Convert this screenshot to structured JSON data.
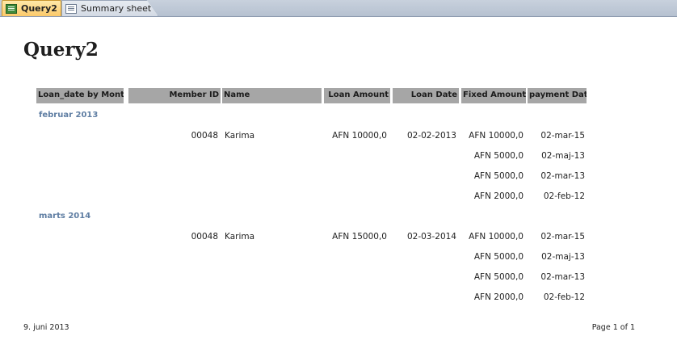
{
  "tabs": [
    {
      "label": "Query2",
      "active": true,
      "icon": "query-icon"
    },
    {
      "label": "Summary sheet",
      "active": false,
      "icon": "report-icon"
    }
  ],
  "report": {
    "title": "Query2",
    "columns": [
      "Loan_date by Month",
      "Member ID",
      "Name",
      "Loan Amount",
      "Loan Date",
      "Fixed Amount",
      "payment Date"
    ],
    "groups": [
      {
        "label": "februar 2013",
        "member_id": "00048",
        "name": "Karima",
        "loan_amount": "AFN 10000,0",
        "loan_date": "02-02-2013",
        "payments": [
          {
            "fixed": "AFN 10000,0",
            "date": "02-mar-15"
          },
          {
            "fixed": "AFN 5000,0",
            "date": "02-maj-13"
          },
          {
            "fixed": "AFN 5000,0",
            "date": "02-mar-13"
          },
          {
            "fixed": "AFN 2000,0",
            "date": "02-feb-12"
          }
        ]
      },
      {
        "label": "marts 2014",
        "member_id": "00048",
        "name": "Karima",
        "loan_amount": "AFN 15000,0",
        "loan_date": "02-03-2014",
        "payments": [
          {
            "fixed": "AFN 10000,0",
            "date": "02-mar-15"
          },
          {
            "fixed": "AFN 5000,0",
            "date": "02-maj-13"
          },
          {
            "fixed": "AFN 5000,0",
            "date": "02-mar-13"
          },
          {
            "fixed": "AFN 2000,0",
            "date": "02-feb-12"
          }
        ]
      }
    ],
    "footer": {
      "date": "9. juni 2013",
      "page": "Page 1 of 1"
    }
  },
  "colors": {
    "header_bg": "#a6a6a6",
    "group_label": "#5f7ea3",
    "active_tab": "#fbc96a"
  }
}
